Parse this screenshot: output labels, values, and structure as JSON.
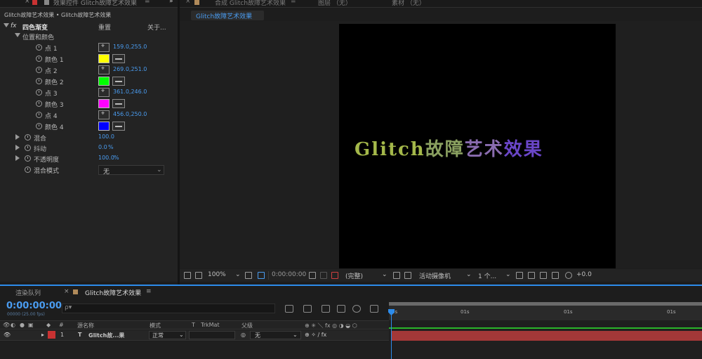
{
  "effect_panel": {
    "tab_label": "效果控件 Glitch故障艺术效果",
    "breadcrumb": "Glitch故障艺术效果 • Glitch故障艺术效果",
    "effect_name": "四色渐变",
    "reset_label": "重置",
    "about_label": "关于...",
    "group_label": "位置和颜色",
    "points": [
      {
        "label": "点 1",
        "value": "159.0,255.0"
      },
      {
        "label": "点 2",
        "value": "269.0,251.0"
      },
      {
        "label": "点 3",
        "value": "361.0,246.0"
      },
      {
        "label": "点 4",
        "value": "456.0,250.0"
      }
    ],
    "colors": [
      {
        "label": "颜色 1",
        "hex": "#ffff00"
      },
      {
        "label": "颜色 2",
        "hex": "#00ff00"
      },
      {
        "label": "颜色 3",
        "hex": "#ff00ff"
      },
      {
        "label": "颜色 4",
        "hex": "#0000ff"
      }
    ],
    "blend": {
      "label": "混合",
      "value": "100.0"
    },
    "jitter": {
      "label": "抖动",
      "value": "0.0",
      "unit": "%"
    },
    "opacity": {
      "label": "不透明度",
      "value": "100.0",
      "unit": "%"
    },
    "blend_mode": {
      "label": "混合模式",
      "value": "无"
    }
  },
  "comp_viewer": {
    "tab_comp": "合成 Glitch故障艺术效果",
    "tab_layer": "图层 （无）",
    "tab_footage": "素材 （无）",
    "subtab": "Glitch故障艺术效果",
    "canvas_text_parts": [
      "Glitch",
      "故障",
      "艺术",
      "效果"
    ],
    "toolbar": {
      "zoom": "100%",
      "timecode": "0:00:00:00",
      "resolution": "(完整)",
      "camera": "活动摄像机",
      "views": "1 个...",
      "exposure": "+0.0"
    }
  },
  "timeline": {
    "tab_render": "渲染队列",
    "tab_comp": "Glitch故障艺术效果",
    "timecode": "0:00:00:00",
    "fps": "00000 (25.00 fps)",
    "search_icon": "ρ▾",
    "columns": {
      "num": "#",
      "source": "源名称",
      "mode": "模式",
      "t": "T",
      "trkmat": "TrkMat",
      "parent": "父级"
    },
    "layer": {
      "index": "1",
      "type": "T",
      "name": "Glitch故...果",
      "mode": "正常",
      "parent": "无",
      "label_color": "#c83232"
    },
    "ruler_ticks": [
      "0s",
      "01s",
      "01s",
      "01s"
    ]
  }
}
